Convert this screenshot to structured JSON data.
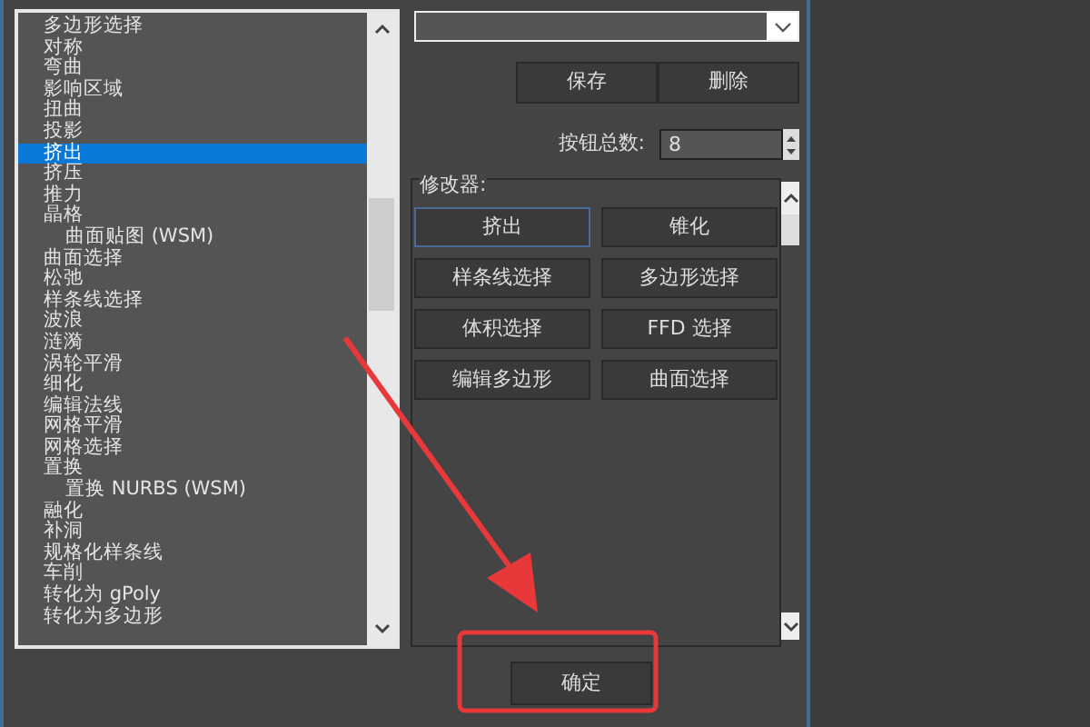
{
  "modifier_list": [
    {
      "label": "多边形选择",
      "kind": "standard",
      "selected": false
    },
    {
      "label": "对称",
      "kind": "standard",
      "selected": false
    },
    {
      "label": "弯曲",
      "kind": "standard",
      "selected": false
    },
    {
      "label": "影响区域",
      "kind": "standard",
      "selected": false
    },
    {
      "label": "扭曲",
      "kind": "standard",
      "selected": false
    },
    {
      "label": "投影",
      "kind": "standard",
      "selected": false
    },
    {
      "label": "挤出",
      "kind": "standard",
      "selected": true
    },
    {
      "label": "挤压",
      "kind": "standard",
      "selected": false
    },
    {
      "label": "推力",
      "kind": "standard",
      "selected": false
    },
    {
      "label": "晶格",
      "kind": "standard",
      "selected": false
    },
    {
      "label": "曲面贴图 (WSM)",
      "kind": "wsm",
      "selected": false
    },
    {
      "label": "曲面选择",
      "kind": "standard",
      "selected": false
    },
    {
      "label": "松弛",
      "kind": "standard",
      "selected": false
    },
    {
      "label": "样条线选择",
      "kind": "standard",
      "selected": false
    },
    {
      "label": "波浪",
      "kind": "standard",
      "selected": false
    },
    {
      "label": "涟漪",
      "kind": "standard",
      "selected": false
    },
    {
      "label": "涡轮平滑",
      "kind": "standard",
      "selected": false
    },
    {
      "label": "细化",
      "kind": "standard",
      "selected": false
    },
    {
      "label": "编辑法线",
      "kind": "standard",
      "selected": false
    },
    {
      "label": "网格平滑",
      "kind": "standard",
      "selected": false
    },
    {
      "label": "网格选择",
      "kind": "standard",
      "selected": false
    },
    {
      "label": "置换",
      "kind": "standard",
      "selected": false
    },
    {
      "label": "置换 NURBS (WSM)",
      "kind": "wsm",
      "selected": false
    },
    {
      "label": "融化",
      "kind": "standard",
      "selected": false
    },
    {
      "label": "补洞",
      "kind": "standard",
      "selected": false
    },
    {
      "label": "规格化样条线",
      "kind": "standard",
      "selected": false
    },
    {
      "label": "车削",
      "kind": "standard",
      "selected": false
    },
    {
      "label": "转化为 gPoly",
      "kind": "standard",
      "selected": false
    },
    {
      "label": "转化为多边形",
      "kind": "standard",
      "selected": false
    }
  ],
  "set_buttons": [
    "保存",
    "删除"
  ],
  "button_count": {
    "label": "按钮总数:",
    "value": "8"
  },
  "modifiers_group": {
    "title": "修改器:",
    "buttons": [
      {
        "label": "挤出",
        "selected": true
      },
      {
        "label": "锥化",
        "selected": false
      },
      {
        "label": "样条线选择",
        "selected": false
      },
      {
        "label": "多边形选择",
        "selected": false
      },
      {
        "label": "体积选择",
        "selected": false
      },
      {
        "label": "FFD 选择",
        "selected": false
      },
      {
        "label": "编辑多边形",
        "selected": false
      },
      {
        "label": "曲面选择",
        "selected": false
      }
    ]
  },
  "ok_button": "确定"
}
